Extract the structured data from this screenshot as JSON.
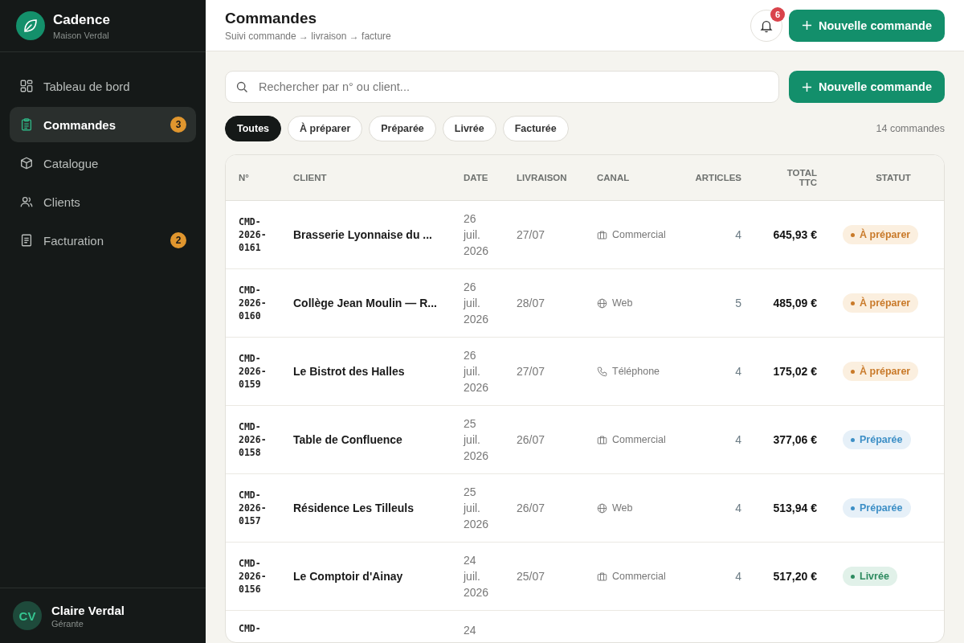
{
  "brand": {
    "name": "Cadence",
    "subtitle": "Maison Verdal"
  },
  "nav": [
    {
      "label": "Tableau de bord",
      "kind": "grid",
      "selected": false
    },
    {
      "label": "Commandes",
      "kind": "clipboard",
      "selected": true,
      "badge": "3"
    },
    {
      "label": "Catalogue",
      "kind": "box",
      "selected": false
    },
    {
      "label": "Clients",
      "kind": "users",
      "selected": false
    },
    {
      "label": "Facturation",
      "kind": "invoice",
      "selected": false,
      "badge": "2"
    }
  ],
  "user": {
    "initials": "CV",
    "name": "Claire Verdal",
    "role": "Gérante"
  },
  "header": {
    "title": "Commandes",
    "subtitle": "Suivi commande → livraison → facture",
    "notifications": "6",
    "button": "Nouvelle commande"
  },
  "search": {
    "placeholder": "Rechercher par n° ou client...",
    "button": "Nouvelle commande"
  },
  "filters": [
    {
      "label": "Toutes",
      "selected": true
    },
    {
      "label": "À préparer",
      "selected": false
    },
    {
      "label": "Préparée",
      "selected": false
    },
    {
      "label": "Livrée",
      "selected": false
    },
    {
      "label": "Facturée",
      "selected": false
    }
  ],
  "count": "14 commandes",
  "table": {
    "columns": [
      "N°",
      "CLIENT",
      "DATE",
      "LIVRAISON",
      "CANAL",
      "ARTICLES",
      "TOTAL TTC",
      "STATUT"
    ],
    "rows": [
      {
        "id": "CMD-2026-0161",
        "client": "Brasserie Lyonnaise du ...",
        "date": "26 juil. 2026",
        "delivery": "27/07",
        "channel": {
          "kind": "commercial",
          "label": "Commercial"
        },
        "articles": "4",
        "total": "645,93 €",
        "status": {
          "kind": "a_preparer",
          "label": "À préparer"
        }
      },
      {
        "id": "CMD-2026-0160",
        "client": "Collège Jean Moulin — R...",
        "date": "26 juil. 2026",
        "delivery": "28/07",
        "channel": {
          "kind": "web",
          "label": "Web"
        },
        "articles": "5",
        "total": "485,09 €",
        "status": {
          "kind": "a_preparer",
          "label": "À préparer"
        }
      },
      {
        "id": "CMD-2026-0159",
        "client": "Le Bistrot des Halles",
        "date": "26 juil. 2026",
        "delivery": "27/07",
        "channel": {
          "kind": "telephone",
          "label": "Téléphone"
        },
        "articles": "4",
        "total": "175,02 €",
        "status": {
          "kind": "a_preparer",
          "label": "À préparer"
        }
      },
      {
        "id": "CMD-2026-0158",
        "client": "Table de Confluence",
        "date": "25 juil. 2026",
        "delivery": "26/07",
        "channel": {
          "kind": "commercial",
          "label": "Commercial"
        },
        "articles": "4",
        "total": "377,06 €",
        "status": {
          "kind": "preparee",
          "label": "Préparée"
        }
      },
      {
        "id": "CMD-2026-0157",
        "client": "Résidence Les Tilleuls",
        "date": "25 juil. 2026",
        "delivery": "26/07",
        "channel": {
          "kind": "web",
          "label": "Web"
        },
        "articles": "4",
        "total": "513,94 €",
        "status": {
          "kind": "preparee",
          "label": "Préparée"
        }
      },
      {
        "id": "CMD-2026-0156",
        "client": "Le Comptoir d'Ainay",
        "date": "24 juil. 2026",
        "delivery": "25/07",
        "channel": {
          "kind": "commercial",
          "label": "Commercial"
        },
        "articles": "4",
        "total": "517,20 €",
        "status": {
          "kind": "livree",
          "label": "Livrée"
        }
      },
      {
        "id": "CMD-",
        "date": "24"
      }
    ]
  }
}
